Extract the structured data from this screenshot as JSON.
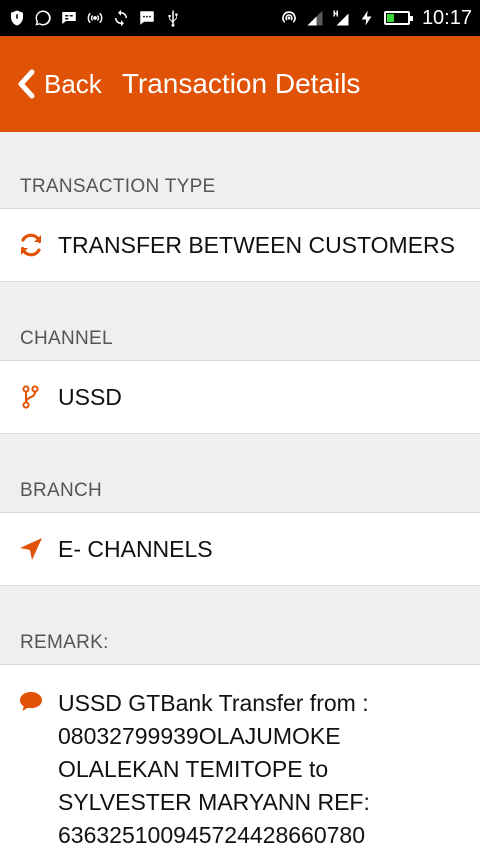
{
  "status_bar": {
    "time": "10:17",
    "icons": [
      "vpn-icon",
      "whatsapp-icon",
      "bbm-icon",
      "hotspot-icon",
      "sync-icon",
      "message-icon",
      "usb-icon",
      "wifi-icon",
      "signal-icon",
      "signal-h-icon",
      "charging-icon",
      "battery-icon"
    ],
    "battery_level": 0.35
  },
  "app_bar": {
    "back_label": "Back",
    "title": "Transaction Details"
  },
  "sections": {
    "type": {
      "label": "TRANSACTION TYPE",
      "value": "TRANSFER BETWEEN CUSTOMERS",
      "icon": "refresh-icon"
    },
    "channel": {
      "label": "CHANNEL",
      "value": "USSD",
      "icon": "branch-icon"
    },
    "branch": {
      "label": "BRANCH",
      "value": "E- CHANNELS",
      "icon": "location-arrow-icon"
    },
    "remark": {
      "label": "REMARK:",
      "value": "USSD GTBank Transfer from : 08032799939OLAJUMOKE OLALEKAN TEMITOPE to SYLVESTER MARYANN REF: 636325100945724428660780",
      "icon": "comment-icon"
    }
  },
  "colors": {
    "accent": "#e05206",
    "background": "#efefef"
  }
}
